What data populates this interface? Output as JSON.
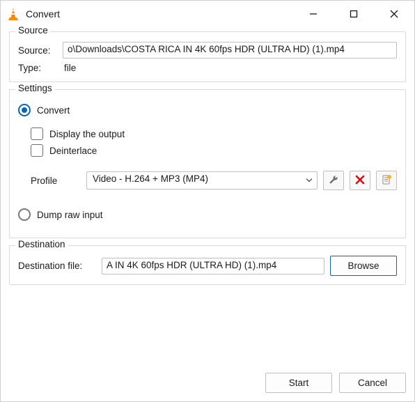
{
  "window": {
    "title": "Convert"
  },
  "source": {
    "legend": "Source",
    "source_label": "Source:",
    "source_value": "o\\Downloads\\COSTA RICA IN 4K 60fps HDR (ULTRA HD) (1).mp4",
    "type_label": "Type:",
    "type_value": "file"
  },
  "settings": {
    "legend": "Settings",
    "convert_label": "Convert",
    "display_output_label": "Display the output",
    "deinterlace_label": "Deinterlace",
    "profile_label": "Profile",
    "profile_value": "Video - H.264 + MP3 (MP4)",
    "dump_raw_label": "Dump raw input"
  },
  "destination": {
    "legend": "Destination",
    "file_label": "Destination file:",
    "file_value": "A IN 4K 60fps HDR (ULTRA HD) (1).mp4",
    "browse_label": "Browse"
  },
  "footer": {
    "start_label": "Start",
    "cancel_label": "Cancel"
  }
}
